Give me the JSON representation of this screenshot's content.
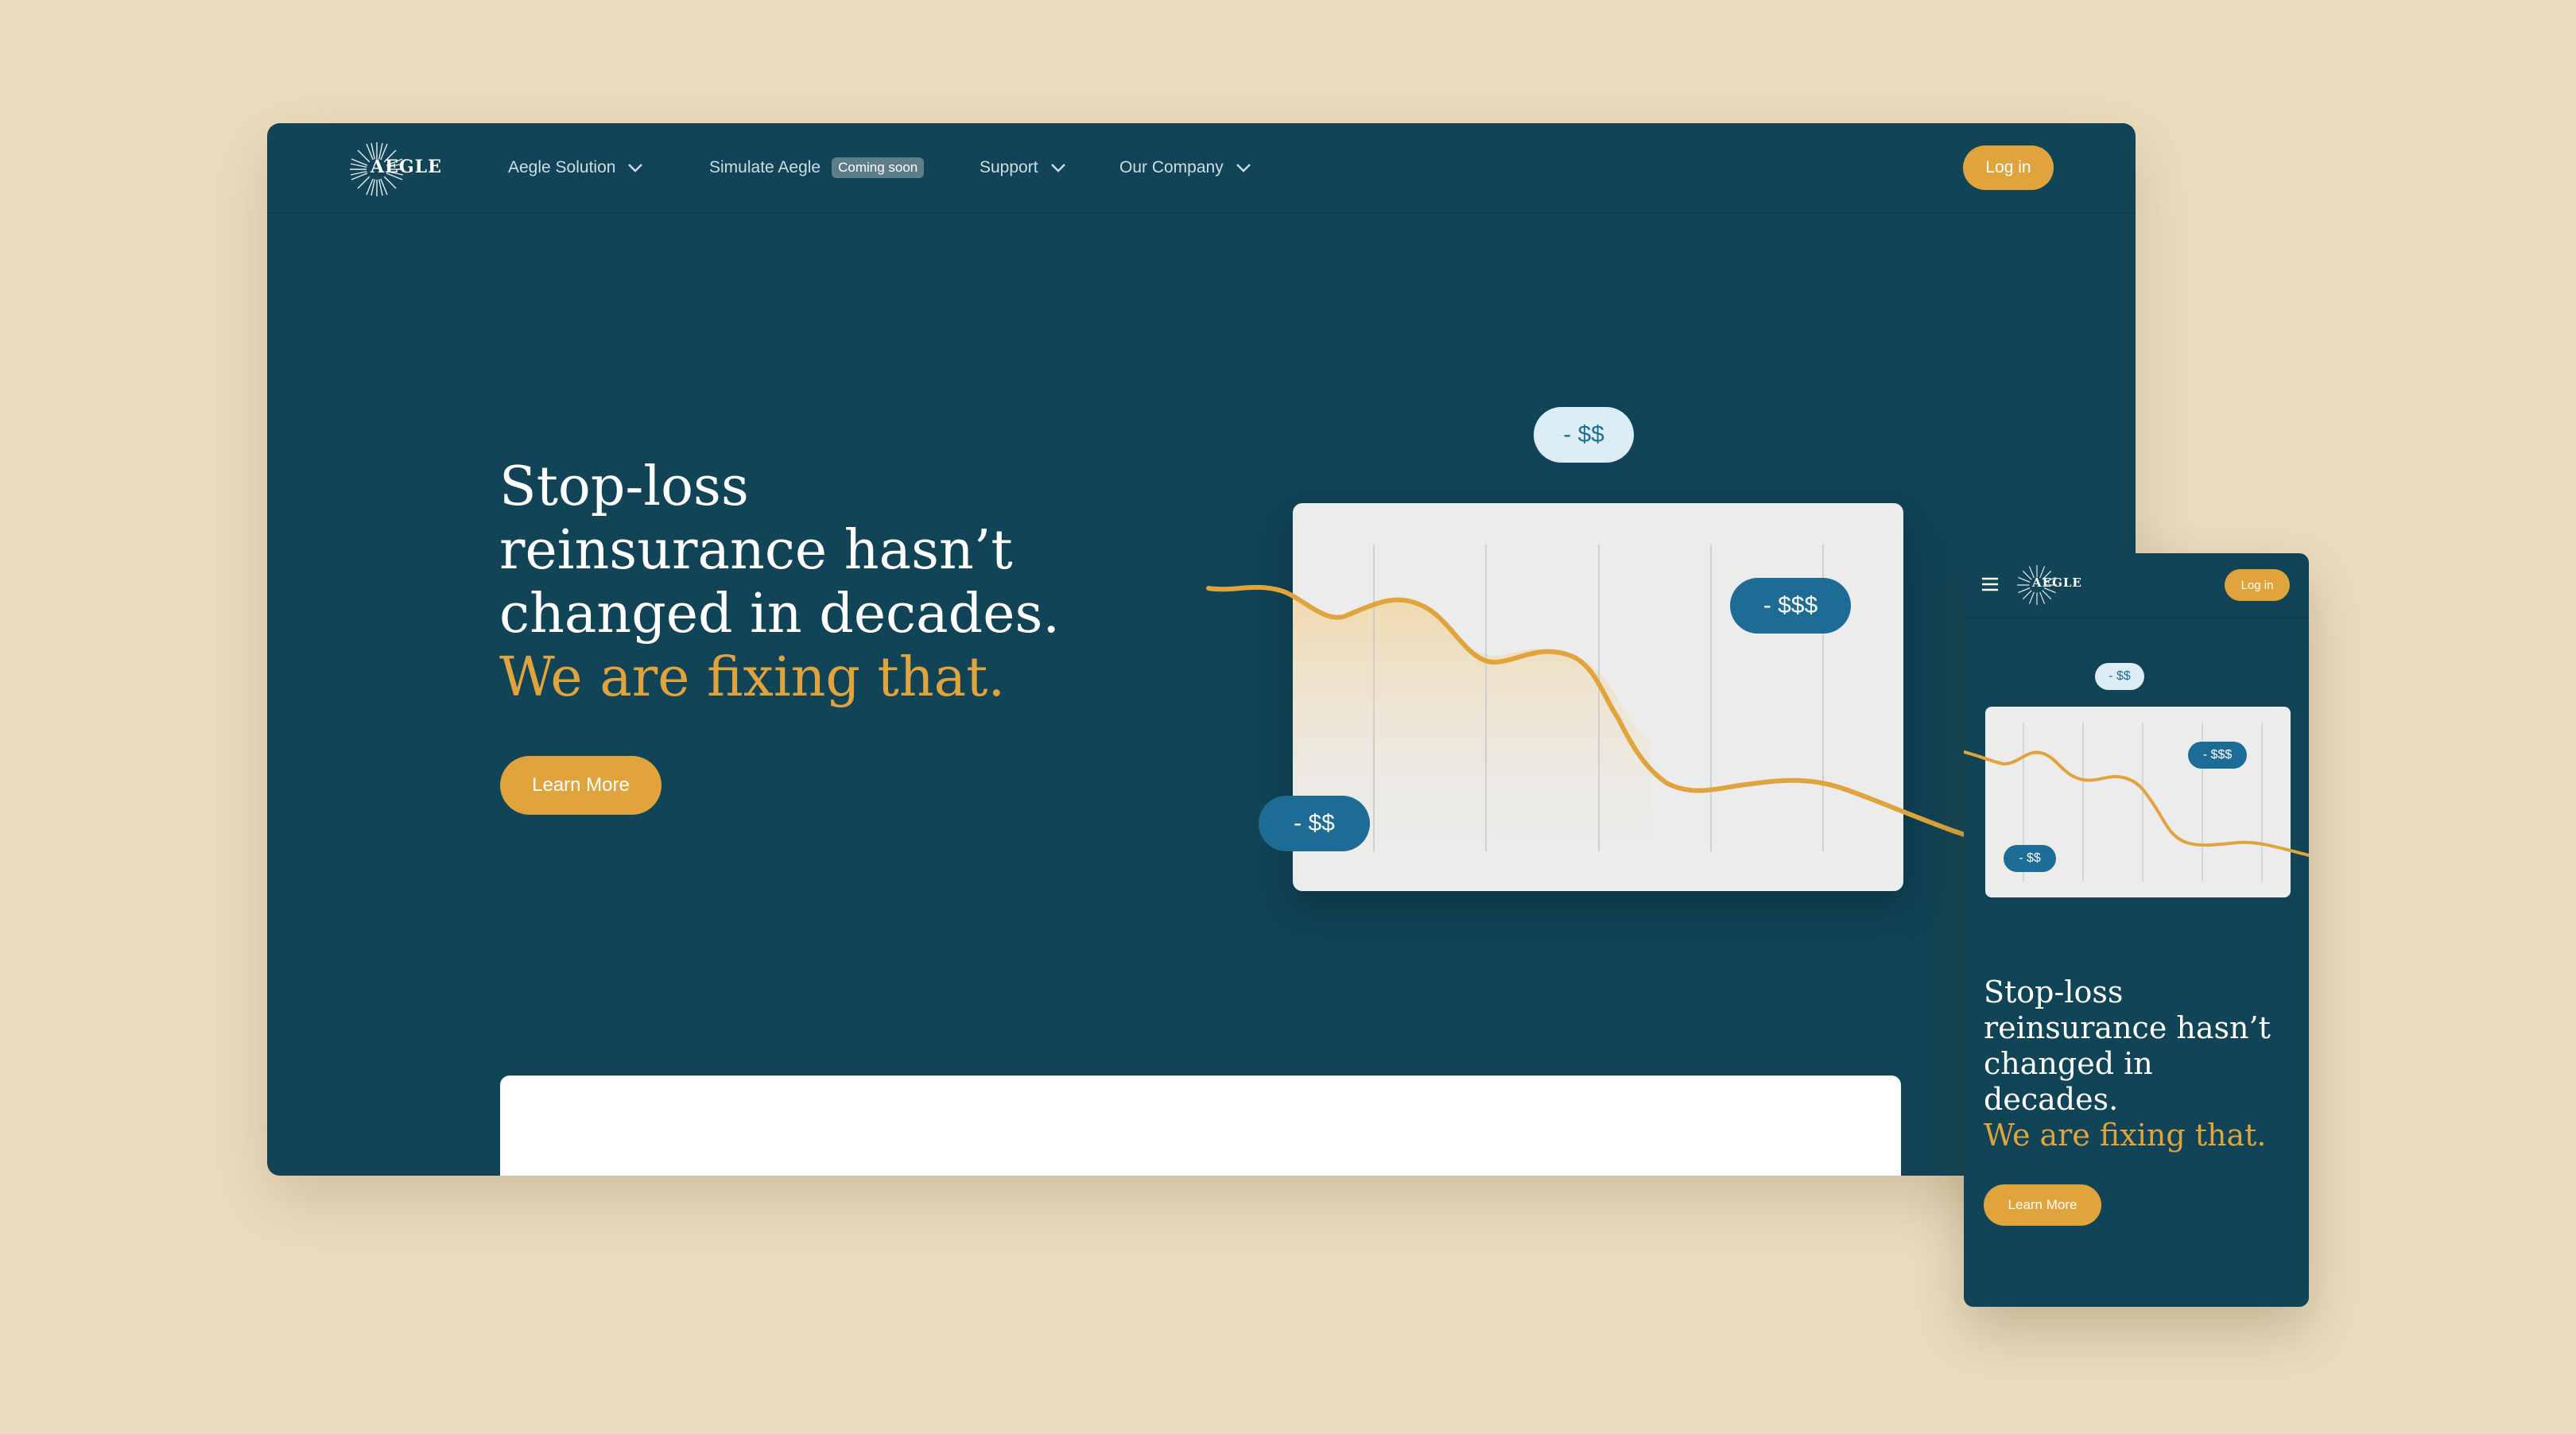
{
  "brand": {
    "name": "AEGLE"
  },
  "colors": {
    "background": "#ecdcbe",
    "primary": "#104456",
    "accent": "#e1a43c",
    "pill_dark": "#1d6c96",
    "pill_light": "#dcedf6"
  },
  "nav": {
    "items": [
      {
        "label": "Aegle Solution",
        "has_dropdown": true
      },
      {
        "label": "Simulate Aegle",
        "badge": "Coming soon",
        "has_dropdown": false
      },
      {
        "label": "Support",
        "has_dropdown": true
      },
      {
        "label": "Our Company",
        "has_dropdown": true
      }
    ],
    "login_label": "Log in"
  },
  "hero": {
    "title_lines": [
      "Stop-loss",
      "reinsurance hasn’t",
      "changed in decades."
    ],
    "accent_line": "We are fixing that.",
    "cta_label": "Learn More"
  },
  "chart": {
    "pills": {
      "top": "- $$",
      "right": "- $$$",
      "left": "- $$"
    }
  },
  "mobile": {
    "menu_icon": "hamburger-icon",
    "login_label": "Log in",
    "title_lines": [
      "Stop-loss",
      "reinsurance hasn’t",
      "changed in",
      "decades."
    ],
    "accent_line": "We are fixing that.",
    "cta_label": "Learn More",
    "pills": {
      "top": "- $$",
      "right": "- $$$",
      "left": "- $$"
    }
  }
}
